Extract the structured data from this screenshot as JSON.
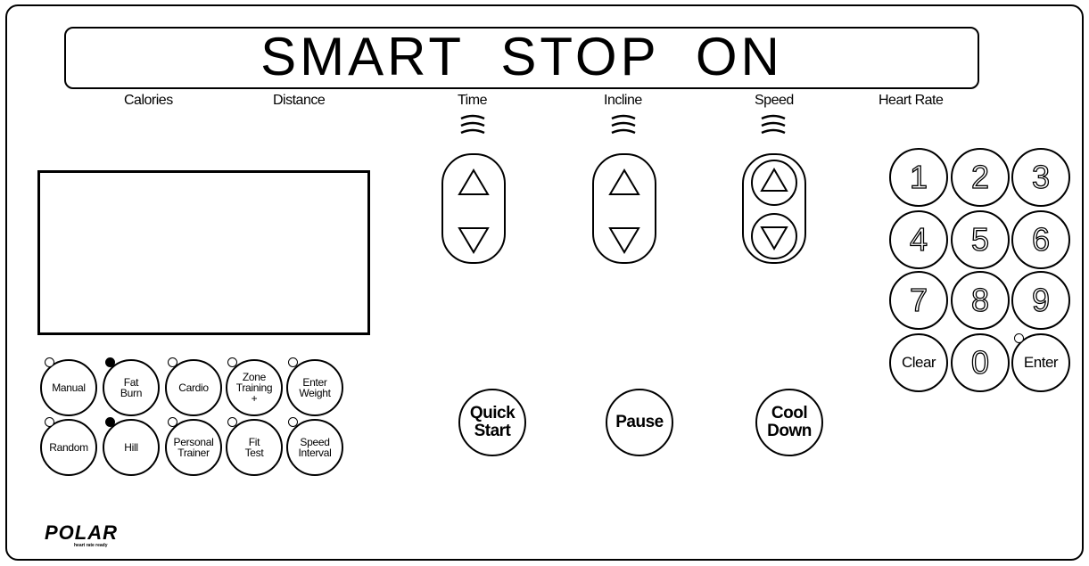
{
  "display": {
    "message": "SMART  STOP  ON"
  },
  "labels": {
    "calories": "Calories",
    "distance": "Distance",
    "time": "Time",
    "incline": "Incline",
    "speed": "Speed",
    "heart_rate": "Heart Rate"
  },
  "programs": {
    "manual": "Manual",
    "fat_burn": [
      "Fat",
      "Burn"
    ],
    "cardio": "Cardio",
    "zone_training": [
      "Zone",
      "Training",
      "+"
    ],
    "enter_weight": [
      "Enter",
      "Weight"
    ],
    "random": "Random",
    "hill": "Hill",
    "personal_trainer": [
      "Personal",
      "Trainer"
    ],
    "fit_test": [
      "Fit",
      "Test"
    ],
    "speed_interval": [
      "Speed",
      "Interval"
    ]
  },
  "controls": {
    "quick_start": [
      "Quick",
      "Start"
    ],
    "pause": "Pause",
    "cool_down": [
      "Cool",
      "Down"
    ]
  },
  "keypad": {
    "keys": [
      "1",
      "2",
      "3",
      "4",
      "5",
      "6",
      "7",
      "8",
      "9"
    ],
    "clear": "Clear",
    "zero": "0",
    "enter": "Enter"
  },
  "led_states": {
    "manual": false,
    "fat_burn": true,
    "cardio": false,
    "zone_training": false,
    "enter_weight": false,
    "random": false,
    "hill": true,
    "personal_trainer": false,
    "fit_test": false,
    "speed_interval": false,
    "enter_key": false
  },
  "branding": {
    "logo": "POLAR",
    "tagline": "heart rate ready"
  }
}
